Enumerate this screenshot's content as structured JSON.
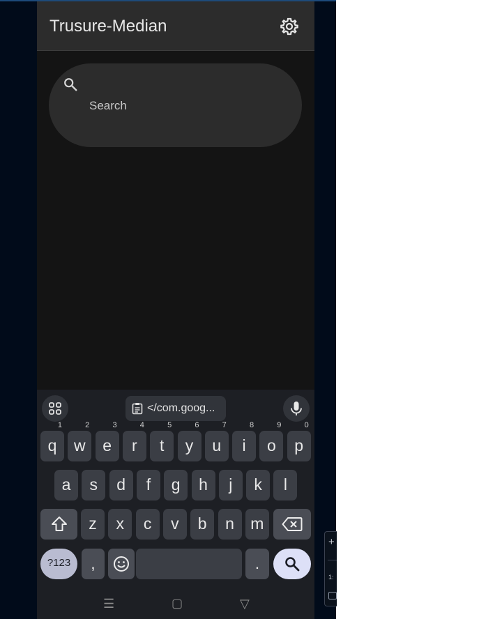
{
  "app": {
    "title": "Trusure-Median",
    "settings_icon": "gear-icon"
  },
  "search": {
    "placeholder": "Search",
    "icon": "search-icon"
  },
  "keyboard": {
    "toolbar": {
      "apps_icon": "apps-grid-icon",
      "clipboard_text": "</com.goog...",
      "clipboard_icon": "clipboard-icon",
      "mic_icon": "mic-icon"
    },
    "row1": [
      {
        "key": "q",
        "hint": "1"
      },
      {
        "key": "w",
        "hint": "2"
      },
      {
        "key": "e",
        "hint": "3"
      },
      {
        "key": "r",
        "hint": "4"
      },
      {
        "key": "t",
        "hint": "5"
      },
      {
        "key": "y",
        "hint": "6"
      },
      {
        "key": "u",
        "hint": "7"
      },
      {
        "key": "i",
        "hint": "8"
      },
      {
        "key": "o",
        "hint": "9"
      },
      {
        "key": "p",
        "hint": "0"
      }
    ],
    "row2": [
      "a",
      "s",
      "d",
      "f",
      "g",
      "h",
      "j",
      "k",
      "l"
    ],
    "row3": [
      "z",
      "x",
      "c",
      "v",
      "b",
      "n",
      "m"
    ],
    "symbols_label": "?123",
    "comma_label": ",",
    "period_label": ".",
    "accent_color": "#dde0f7"
  },
  "side_widget": {
    "plus": "+",
    "text": "1:"
  }
}
